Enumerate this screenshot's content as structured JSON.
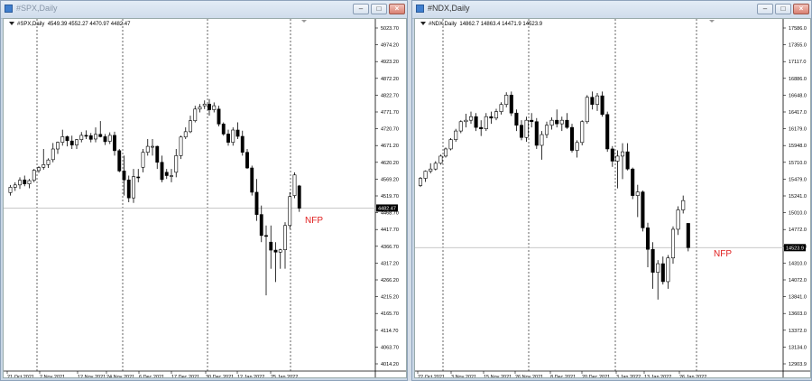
{
  "windows": [
    {
      "title": "#SPX,Daily",
      "chart_header": {
        "symbol": "#SPX,Daily",
        "ohlc": "4549.39 4552.27 4470.97 4482.47"
      },
      "current_price": "4482.47",
      "annotation": "NFP"
    },
    {
      "title": "#NDX,Daily",
      "chart_header": {
        "symbol": "#NDX,Daily",
        "ohlc": "14862.7 14863.4 14471.9 14523.9"
      },
      "current_price": "14523.9",
      "annotation": "NFP"
    }
  ],
  "chart_data": [
    {
      "type": "candlestick",
      "title": "#SPX,Daily",
      "ylim": [
        4014.2,
        5023.7
      ],
      "y_ticks": [
        "5023.70",
        "4974.20",
        "4923.20",
        "4872.20",
        "4822.70",
        "4771.70",
        "4720.70",
        "4671.20",
        "4620.20",
        "4569.20",
        "4519.70",
        "4468.70",
        "4417.70",
        "4366.70",
        "4317.20",
        "4266.20",
        "4215.20",
        "4165.70",
        "4114.70",
        "4063.70",
        "4014.20"
      ],
      "x_labels": [
        "21 Oct 2021",
        "2 Nov 2021",
        "12 Nov 2021",
        "24 Nov 2021",
        "6 Dec 2021",
        "17 Dec 2021",
        "30 Dec 2021",
        "12 Jan 2022",
        "25 Jan 2022"
      ],
      "period_separators": [
        "1 Nov 2021",
        "1 Dec 2021",
        "3 Jan 2022",
        "1 Feb 2022"
      ],
      "current_price": 4482.47,
      "candles": [
        [
          4529,
          4552,
          4520,
          4545
        ],
        [
          4545,
          4560,
          4534,
          4552
        ],
        [
          4552,
          4575,
          4540,
          4566
        ],
        [
          4567,
          4580,
          4548,
          4555
        ],
        [
          4555,
          4570,
          4542,
          4565
        ],
        [
          4566,
          4600,
          4560,
          4596
        ],
        [
          4595,
          4608,
          4588,
          4604
        ],
        [
          4605,
          4660,
          4598,
          4613
        ],
        [
          4613,
          4632,
          4603,
          4627
        ],
        [
          4628,
          4678,
          4620,
          4660
        ],
        [
          4660,
          4682,
          4645,
          4680
        ],
        [
          4680,
          4718,
          4670,
          4697
        ],
        [
          4697,
          4700,
          4668,
          4685
        ],
        [
          4684,
          4700,
          4660,
          4672
        ],
        [
          4672,
          4690,
          4660,
          4688
        ],
        [
          4688,
          4711,
          4680,
          4701
        ],
        [
          4701,
          4716,
          4690,
          4700
        ],
        [
          4700,
          4708,
          4680,
          4689
        ],
        [
          4690,
          4725,
          4680,
          4704
        ],
        [
          4704,
          4744,
          4695,
          4697
        ],
        [
          4697,
          4705,
          4672,
          4682
        ],
        [
          4683,
          4710,
          4675,
          4701
        ],
        [
          4701,
          4712,
          4640,
          4655
        ],
        [
          4655,
          4660,
          4590,
          4594
        ],
        [
          4594,
          4640,
          4520,
          4567
        ],
        [
          4567,
          4580,
          4500,
          4513
        ],
        [
          4513,
          4600,
          4498,
          4577
        ],
        [
          4576,
          4600,
          4560,
          4575
        ],
        [
          4605,
          4660,
          4590,
          4650
        ],
        [
          4650,
          4690,
          4640,
          4668
        ],
        [
          4668,
          4690,
          4640,
          4668
        ],
        [
          4668,
          4670,
          4600,
          4620
        ],
        [
          4620,
          4640,
          4560,
          4568
        ],
        [
          4590,
          4600,
          4570,
          4580
        ],
        [
          4580,
          4600,
          4560,
          4580
        ],
        [
          4590,
          4660,
          4575,
          4640
        ],
        [
          4640,
          4700,
          4630,
          4696
        ],
        [
          4696,
          4725,
          4690,
          4712
        ],
        [
          4712,
          4760,
          4708,
          4745
        ],
        [
          4745,
          4790,
          4740,
          4780
        ],
        [
          4780,
          4795,
          4770,
          4786
        ],
        [
          4790,
          4806,
          4780,
          4795
        ],
        [
          4795,
          4810,
          4760,
          4778
        ],
        [
          4778,
          4800,
          4770,
          4790
        ],
        [
          4780,
          4790,
          4728,
          4735
        ],
        [
          4735,
          4740,
          4700,
          4705
        ],
        [
          4705,
          4718,
          4670,
          4680
        ],
        [
          4680,
          4725,
          4670,
          4717
        ],
        [
          4717,
          4740,
          4690,
          4698
        ],
        [
          4698,
          4715,
          4640,
          4650
        ],
        [
          4650,
          4660,
          4600,
          4603
        ],
        [
          4603,
          4610,
          4520,
          4530
        ],
        [
          4530,
          4570,
          4444,
          4463
        ],
        [
          4463,
          4490,
          4380,
          4400
        ],
        [
          4400,
          4430,
          4220,
          4399
        ],
        [
          4380,
          4430,
          4300,
          4356
        ],
        [
          4356,
          4380,
          4260,
          4350
        ],
        [
          4350,
          4360,
          4300,
          4357
        ],
        [
          4357,
          4440,
          4300,
          4430
        ],
        [
          4430,
          4530,
          4420,
          4517
        ],
        [
          4520,
          4590,
          4512,
          4582
        ],
        [
          4549,
          4552,
          4471,
          4482
        ]
      ]
    },
    {
      "type": "candlestick",
      "title": "#NDX,Daily",
      "ylim": [
        12903.9,
        17586.0
      ],
      "y_ticks": [
        "17586.0",
        "17355.0",
        "17117.0",
        "16886.0",
        "16648.0",
        "16417.0",
        "16179.0",
        "15948.0",
        "15710.0",
        "15479.0",
        "15241.0",
        "15010.0",
        "14772.0",
        "14541.0",
        "14310.0",
        "14072.0",
        "13841.0",
        "13603.0",
        "13372.0",
        "13134.0",
        "12903.9"
      ],
      "x_labels": [
        "22 Oct 2021",
        "3 Nov 2021",
        "15 Nov 2021",
        "26 Nov 2021",
        "8 Dec 2021",
        "20 Dec 2021",
        "3 Jan 2022",
        "13 Jan 2022",
        "26 Jan 2022"
      ],
      "period_separators": [
        "1 Nov 2021",
        "1 Dec 2021",
        "3 Jan 2022",
        "1 Feb 2022"
      ],
      "current_price": 14523.9,
      "candles": [
        [
          15390,
          15510,
          15370,
          15490
        ],
        [
          15490,
          15600,
          15440,
          15590
        ],
        [
          15590,
          15700,
          15560,
          15620
        ],
        [
          15620,
          15730,
          15600,
          15700
        ],
        [
          15700,
          15820,
          15680,
          15800
        ],
        [
          15800,
          15920,
          15780,
          15900
        ],
        [
          15900,
          16050,
          15880,
          16030
        ],
        [
          16030,
          16180,
          16000,
          16150
        ],
        [
          16150,
          16300,
          16120,
          16280
        ],
        [
          16280,
          16390,
          16200,
          16300
        ],
        [
          16300,
          16420,
          16250,
          16350
        ],
        [
          16350,
          16400,
          16150,
          16200
        ],
        [
          16200,
          16300,
          16080,
          16180
        ],
        [
          16180,
          16400,
          16150,
          16350
        ],
        [
          16350,
          16420,
          16250,
          16330
        ],
        [
          16330,
          16460,
          16300,
          16420
        ],
        [
          16420,
          16550,
          16380,
          16520
        ],
        [
          16520,
          16690,
          16480,
          16650
        ],
        [
          16650,
          16700,
          16360,
          16400
        ],
        [
          16400,
          16450,
          16150,
          16230
        ],
        [
          16230,
          16300,
          16020,
          16060
        ],
        [
          16060,
          16350,
          16000,
          16300
        ],
        [
          16300,
          16400,
          16200,
          16280
        ],
        [
          16280,
          16330,
          15900,
          15950
        ],
        [
          15950,
          16150,
          15750,
          16100
        ],
        [
          16100,
          16280,
          16050,
          16230
        ],
        [
          16230,
          16340,
          16170,
          16300
        ],
        [
          16300,
          16450,
          16200,
          16250
        ],
        [
          16250,
          16350,
          16150,
          16300
        ],
        [
          16300,
          16400,
          16180,
          16200
        ],
        [
          16200,
          16250,
          15850,
          15880
        ],
        [
          15880,
          16020,
          15780,
          15990
        ],
        [
          15990,
          16300,
          15950,
          16280
        ],
        [
          16280,
          16650,
          16250,
          16620
        ],
        [
          16620,
          16700,
          16450,
          16520
        ],
        [
          16520,
          16680,
          16430,
          16640
        ],
        [
          16640,
          16700,
          16350,
          16380
        ],
        [
          16380,
          16420,
          15860,
          15900
        ],
        [
          15900,
          15940,
          15650,
          15730
        ],
        [
          15730,
          15880,
          15350,
          15800
        ],
        [
          15800,
          15980,
          15480,
          15860
        ],
        [
          15860,
          15980,
          15600,
          15620
        ],
        [
          15620,
          15640,
          15200,
          15250
        ],
        [
          15250,
          15400,
          14950,
          15300
        ],
        [
          15300,
          15320,
          14750,
          14800
        ],
        [
          14800,
          14870,
          14250,
          14500
        ],
        [
          14500,
          14600,
          13950,
          14180
        ],
        [
          14180,
          14350,
          13800,
          14300
        ],
        [
          14300,
          14400,
          14010,
          14050
        ],
        [
          14050,
          14420,
          13950,
          14380
        ],
        [
          14380,
          14820,
          14300,
          14780
        ],
        [
          14780,
          15100,
          14700,
          15050
        ],
        [
          15050,
          15250,
          15000,
          15180
        ],
        [
          14862,
          14863,
          14472,
          14524
        ]
      ]
    }
  ]
}
